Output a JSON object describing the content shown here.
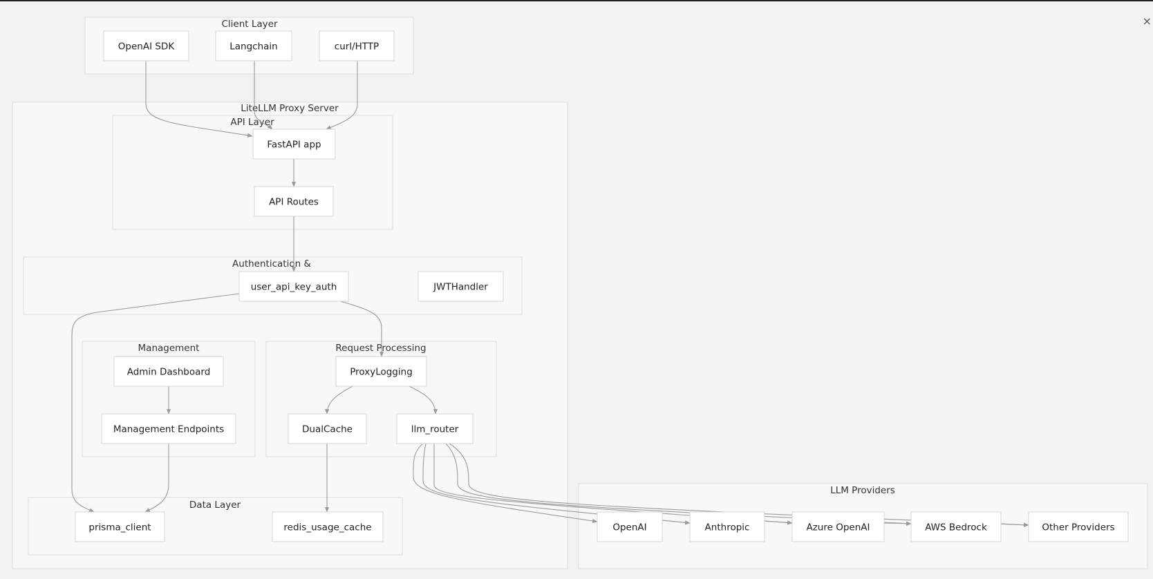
{
  "close_glyph": "×",
  "diagram": {
    "clusters": [
      {
        "id": "client",
        "label": "Client Layer"
      },
      {
        "id": "proxy",
        "label": "LiteLLM Proxy Server"
      },
      {
        "id": "api",
        "label": "API Layer"
      },
      {
        "id": "auth",
        "label": "Authentication &"
      },
      {
        "id": "mgmt",
        "label": "Management"
      },
      {
        "id": "reqproc",
        "label": "Request Processing"
      },
      {
        "id": "data",
        "label": "Data Layer"
      },
      {
        "id": "providers",
        "label": "LLM Providers"
      }
    ],
    "nodes": [
      {
        "id": "openai_sdk",
        "label": "OpenAI SDK",
        "cluster": "client"
      },
      {
        "id": "langchain",
        "label": "Langchain",
        "cluster": "client"
      },
      {
        "id": "curl",
        "label": "curl/HTTP",
        "cluster": "client"
      },
      {
        "id": "fastapi",
        "label": "FastAPI app",
        "cluster": "api"
      },
      {
        "id": "routes",
        "label": "API Routes",
        "cluster": "api"
      },
      {
        "id": "uaka",
        "label": "user_api_key_auth",
        "cluster": "auth"
      },
      {
        "id": "jwt",
        "label": "JWTHandler",
        "cluster": "auth"
      },
      {
        "id": "admin",
        "label": "Admin Dashboard",
        "cluster": "mgmt"
      },
      {
        "id": "mgmt_ep",
        "label": "Management Endpoints",
        "cluster": "mgmt"
      },
      {
        "id": "proxylog",
        "label": "ProxyLogging",
        "cluster": "reqproc"
      },
      {
        "id": "dualcache",
        "label": "DualCache",
        "cluster": "reqproc"
      },
      {
        "id": "router",
        "label": "llm_router",
        "cluster": "reqproc"
      },
      {
        "id": "prisma",
        "label": "prisma_client",
        "cluster": "data"
      },
      {
        "id": "redis",
        "label": "redis_usage_cache",
        "cluster": "data"
      },
      {
        "id": "p_openai",
        "label": "OpenAI",
        "cluster": "providers"
      },
      {
        "id": "p_anthropic",
        "label": "Anthropic",
        "cluster": "providers"
      },
      {
        "id": "p_azure",
        "label": "Azure OpenAI",
        "cluster": "providers"
      },
      {
        "id": "p_bedrock",
        "label": "AWS Bedrock",
        "cluster": "providers"
      },
      {
        "id": "p_other",
        "label": "Other Providers",
        "cluster": "providers"
      }
    ],
    "edges": [
      {
        "from": "openai_sdk",
        "to": "fastapi"
      },
      {
        "from": "langchain",
        "to": "fastapi"
      },
      {
        "from": "curl",
        "to": "fastapi"
      },
      {
        "from": "fastapi",
        "to": "routes"
      },
      {
        "from": "routes",
        "to": "uaka"
      },
      {
        "from": "uaka",
        "to": "prisma"
      },
      {
        "from": "uaka",
        "to": "proxylog"
      },
      {
        "from": "admin",
        "to": "mgmt_ep"
      },
      {
        "from": "mgmt_ep",
        "to": "prisma"
      },
      {
        "from": "proxylog",
        "to": "dualcache"
      },
      {
        "from": "proxylog",
        "to": "router"
      },
      {
        "from": "dualcache",
        "to": "redis"
      },
      {
        "from": "router",
        "to": "p_openai"
      },
      {
        "from": "router",
        "to": "p_anthropic"
      },
      {
        "from": "router",
        "to": "p_azure"
      },
      {
        "from": "router",
        "to": "p_bedrock"
      },
      {
        "from": "router",
        "to": "p_other"
      },
      {
        "from": "p_openai",
        "to": "p_anthropic"
      },
      {
        "from": "p_anthropic",
        "to": "p_azure"
      },
      {
        "from": "p_azure",
        "to": "p_bedrock"
      },
      {
        "from": "p_bedrock",
        "to": "p_other"
      }
    ]
  }
}
